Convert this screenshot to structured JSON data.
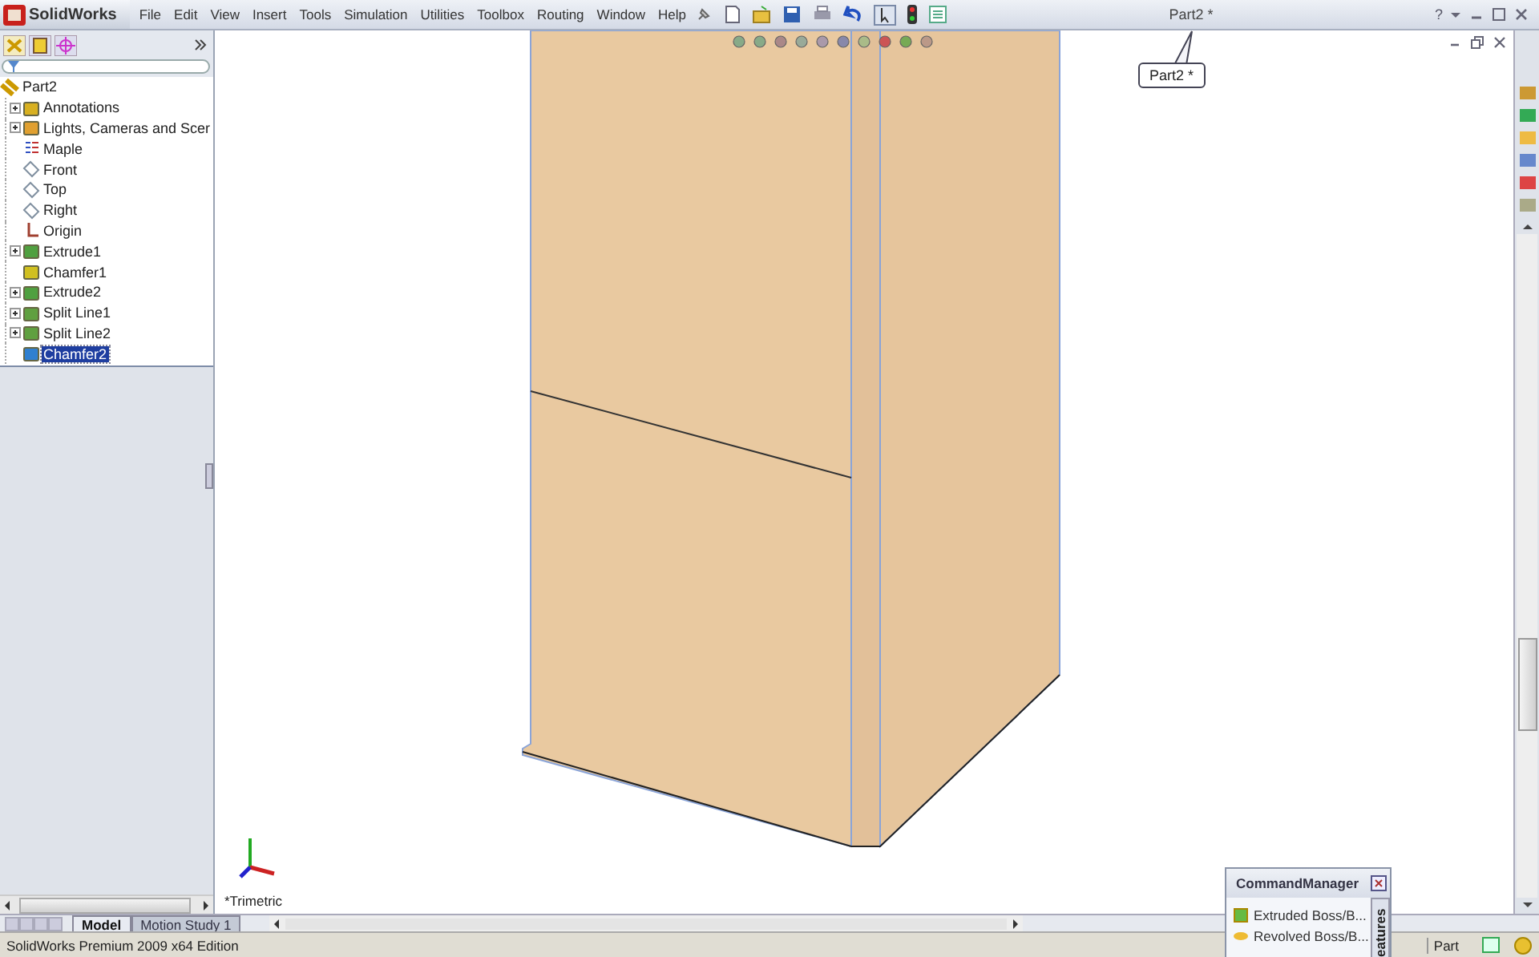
{
  "app": {
    "logo_text": "SolidWorks"
  },
  "menu": [
    "File",
    "Edit",
    "View",
    "Insert",
    "Tools",
    "Simulation",
    "Utilities",
    "Toolbox",
    "Routing",
    "Window",
    "Help"
  ],
  "window": {
    "title": "Part2 *",
    "help_glyph": "?"
  },
  "tooltip": {
    "text": "Part2 *"
  },
  "feature_tree": {
    "root": "Part2",
    "children": [
      {
        "label": "Annotations",
        "kind": "annotations",
        "collapsible": true,
        "selected": false
      },
      {
        "label": "Lights, Cameras and Scer",
        "kind": "lights",
        "collapsible": true,
        "selected": false
      },
      {
        "label": "Maple",
        "kind": "material",
        "collapsible": false,
        "selected": false
      },
      {
        "label": "Front",
        "kind": "plane",
        "collapsible": false,
        "selected": false
      },
      {
        "label": "Top",
        "kind": "plane",
        "collapsible": false,
        "selected": false
      },
      {
        "label": "Right",
        "kind": "plane",
        "collapsible": false,
        "selected": false
      },
      {
        "label": "Origin",
        "kind": "origin",
        "collapsible": false,
        "selected": false
      },
      {
        "label": "Extrude1",
        "kind": "extrude",
        "collapsible": true,
        "selected": false
      },
      {
        "label": "Chamfer1",
        "kind": "chamfer",
        "collapsible": false,
        "selected": false
      },
      {
        "label": "Extrude2",
        "kind": "extrude",
        "collapsible": true,
        "selected": false
      },
      {
        "label": "Split Line1",
        "kind": "split",
        "collapsible": true,
        "selected": false
      },
      {
        "label": "Split Line2",
        "kind": "split",
        "collapsible": true,
        "selected": false
      },
      {
        "label": "Chamfer2",
        "kind": "chamfer2",
        "collapsible": false,
        "selected": true
      }
    ]
  },
  "viewport": {
    "view_label": "*Trimetric"
  },
  "bottom_tabs": [
    {
      "label": "Model",
      "selected": true
    },
    {
      "label": "Motion Study 1",
      "selected": false
    }
  ],
  "command_manager": {
    "title": "CommandManager",
    "items": [
      "Extruded Boss/B...",
      "Revolved Boss/B..."
    ],
    "side_tab": "eatures"
  },
  "status_bar": {
    "text": "SolidWorks Premium 2009 x64 Edition",
    "document_type": "Part"
  }
}
